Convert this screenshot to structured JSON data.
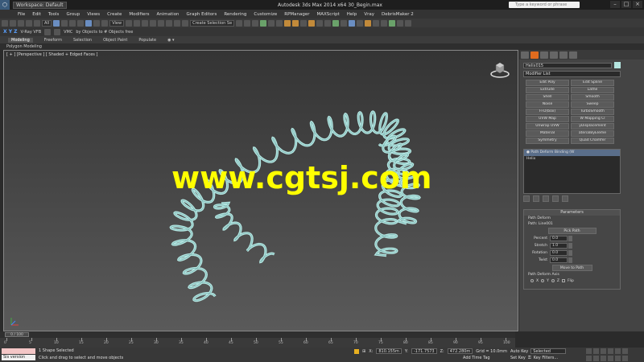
{
  "titlebar": {
    "workspace": "Workspace: Default",
    "title": "Autodesk 3ds Max 2014 x64      30_Begin.max",
    "search_placeholder": "Type a keyword or phrase"
  },
  "menu": [
    "File",
    "Edit",
    "Tools",
    "Group",
    "Views",
    "Create",
    "Modifiers",
    "Animation",
    "Graph Editors",
    "Rendering",
    "Customize",
    "RPManager",
    "MAXScript",
    "Help",
    "Vray",
    "DebrisMaker 2"
  ],
  "toolbar": {
    "filter": "All",
    "ref_coord": "View",
    "named_sel": "Create Selection Se"
  },
  "toolbar2": {
    "xyz": "X Y Z",
    "vray": "V-Ray VFB",
    "vmc": "VMC",
    "objects": "by Objects  to  # Objects  free"
  },
  "ribbon": {
    "tabs": [
      "Modeling",
      "Freeform",
      "Selection",
      "Object Paint",
      "Populate"
    ],
    "sub": "Polygon Modeling"
  },
  "viewport": {
    "label": "[ + ] [Perspective ] [ Shaded + Edged Faces ]",
    "watermark": "www.cgtsj.com",
    "spring_color": "#b4e6e2"
  },
  "cmdpanel": {
    "object_name": "Helix015",
    "modifier_list": "Modifier List",
    "modifier_buttons": [
      "Edit Poly",
      "Edit Spline",
      "Extrude",
      "Lathe",
      "Shell",
      "Smooth",
      "Noise",
      "Sweep",
      "FFD(box)",
      "TurboSmooth",
      "UVW Map",
      "W Mapping Cl",
      "Unwrap UVW",
      "yDisplacement",
      "Material",
      "aterialByEleme",
      "Symmetry",
      "Quad Chamfer"
    ],
    "stack": [
      "Path Deform Binding (W",
      "Helix"
    ],
    "params_title": "Parameters",
    "path_deform_group": "Path Deform",
    "path_label": "Path: Line001",
    "pick_path": "Pick Path",
    "params": [
      {
        "label": "Percent",
        "value": "0.0"
      },
      {
        "label": "Stretch",
        "value": "1.0"
      },
      {
        "label": "Rotation",
        "value": "0.0"
      },
      {
        "label": "Twist",
        "value": "0.0"
      }
    ],
    "move_to_path": "Move to Path",
    "axis_group": "Path Deform Axis",
    "axes": [
      "X",
      "Y",
      "Z",
      "Flip"
    ]
  },
  "timeline": {
    "slider_label": "0 / 100",
    "ticks": [
      "0",
      "5",
      "10",
      "15",
      "20",
      "25",
      "30",
      "35",
      "40",
      "45",
      "50",
      "55",
      "60",
      "65",
      "70",
      "75",
      "80",
      "85",
      "90",
      "95",
      "100"
    ]
  },
  "status": {
    "maxscript_label": "Sis version",
    "line1": "1 Shape Selected",
    "line2": "Click and drag to select and move objects",
    "x": "810.155m",
    "y": "-171.7573",
    "z": "472.280m",
    "grid": "Grid = 10.0mm",
    "add_time_tag": "Add Time Tag",
    "auto_key": "Auto Key",
    "selected": "Selected",
    "set_key": "Set Key",
    "key_filters": "Key Filters..."
  }
}
